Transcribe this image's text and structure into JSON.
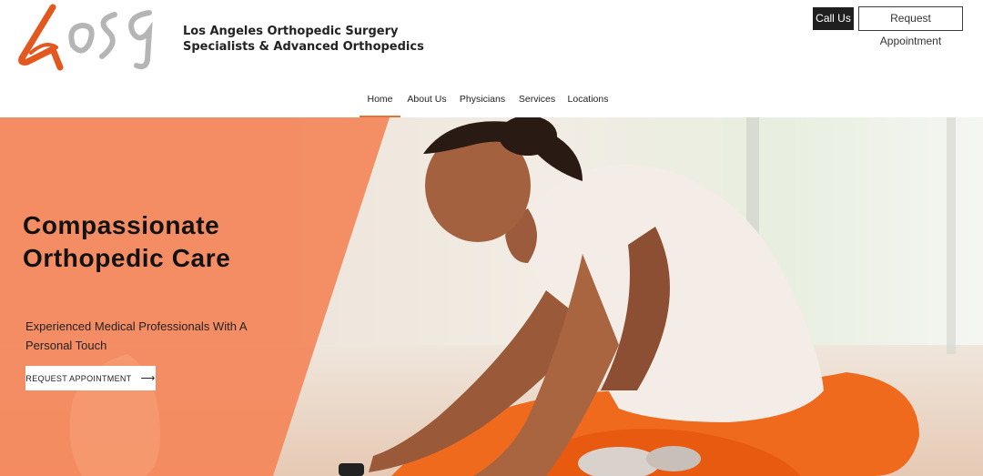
{
  "header": {
    "brand_name": "Los Angeles Orthopedic Surgery Specialists & Advanced Orthopedics",
    "call_label": "Call Us",
    "request_label": "Request Appointment"
  },
  "nav": {
    "items": [
      {
        "label": "Home",
        "active": true
      },
      {
        "label": "About Us",
        "active": false
      },
      {
        "label": "Physicians",
        "active": false
      },
      {
        "label": "Services",
        "active": false
      },
      {
        "label": "Locations",
        "active": false
      }
    ]
  },
  "hero": {
    "title": "Compassionate Orthopedic Care",
    "subtitle": "Experienced Medical Professionals With A Personal Touch",
    "cta_label": "REQUEST APPOINTMENT",
    "cta_icon": "arrow-right-icon"
  },
  "colors": {
    "accent": "#e8703b",
    "overlay": "#f4875a",
    "dark_button": "#1f1f1f",
    "logo_orange": "#e2581f",
    "logo_gray": "#b5b5b5"
  }
}
